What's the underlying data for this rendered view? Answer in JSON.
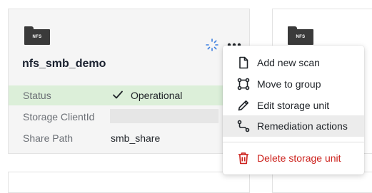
{
  "card": {
    "folder_label": "NFS",
    "title": "nfs_smb_demo",
    "rows": {
      "status_label": "Status",
      "status_value": "Operational",
      "clientid_label": "Storage ClientId",
      "clientid_value": "",
      "sharepath_label": "Share Path",
      "sharepath_value": "smb_share"
    }
  },
  "right_card": {
    "folder_label": "NFS"
  },
  "menu": {
    "items": [
      {
        "label": "Add new scan",
        "icon": "file-icon"
      },
      {
        "label": "Move to group",
        "icon": "group-icon"
      },
      {
        "label": "Edit storage unit",
        "icon": "pencil-icon"
      },
      {
        "label": "Remediation actions",
        "icon": "remediation-icon"
      },
      {
        "label": "Delete storage unit",
        "icon": "trash-icon"
      }
    ]
  },
  "colors": {
    "status_bg": "#dcefd9",
    "danger": "#cc1f1a",
    "sync_blue": "#3d7fe0"
  }
}
